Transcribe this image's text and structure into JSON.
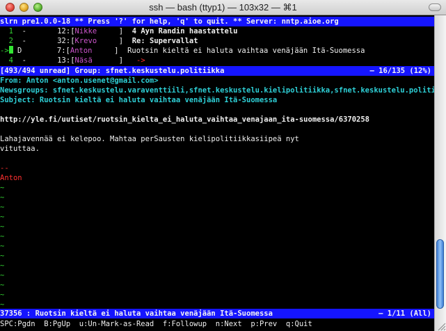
{
  "window": {
    "title": "ssh — bash (ttyp1) — 103x32 — ⌘1"
  },
  "header_bar": "slrn pre1.0.0-18 ** Press '?' for help, 'q' to quit. ** Server: nntp.aioe.org",
  "threads": [
    {
      "num": "1",
      "flag": "-",
      "count": "12:",
      "author": "Nikke",
      "subject": "4 Ayn Randin haastattelu"
    },
    {
      "num": "2",
      "flag": "-",
      "count": "32:",
      "author": "Krevo",
      "subject": "Re: Supervallat"
    },
    {
      "num": "3",
      "flag": "D",
      "count": "7:",
      "author": "Anton",
      "subject": "Ruotsin kieltä ei haluta vaihtaa venäjään Itä-Suomessa"
    },
    {
      "num": "4",
      "flag": "-",
      "count": "13:",
      "author": "Näsä",
      "subject": "->"
    }
  ],
  "group_bar": {
    "left": "[493/494 unread] Group: sfnet.keskustelu.politiikka",
    "right": "— 16/135 (12%)"
  },
  "article": {
    "from": "From: Anton <anton.usenet@gmail.com>",
    "newsgroups": "Newsgroups: sfnet.keskustelu.varaventtiili,sfnet.keskustelu.kielipolitiikka,sfnet.keskustelu.politiikka",
    "subject": "Subject: Ruotsin kieltä ei haluta vaihtaa venäjään Itä-Suomessa",
    "url": "http://yle.fi/uutiset/ruotsin_kielta_ei_haluta_vaihtaa_venajaan_ita-suomessa/6370258",
    "body1": "Lahajavennää ei kelepoo. Mahtaa perSausten kielipolitiikkasiipeä nyt",
    "body2": "vituttaa.",
    "sig_sep": "--",
    "sig": "Anton"
  },
  "tilde": "~",
  "article_bar": {
    "left": "37356 : Ruotsin kieltä ei haluta vaihtaa venäjään Itä-Suomessa",
    "right": "— 1/11 (All)"
  },
  "help_line": "SPC:Pgdn  B:PgUp  u:Un-Mark-as-Read  f:Followup  n:Next  p:Prev  q:Quit"
}
